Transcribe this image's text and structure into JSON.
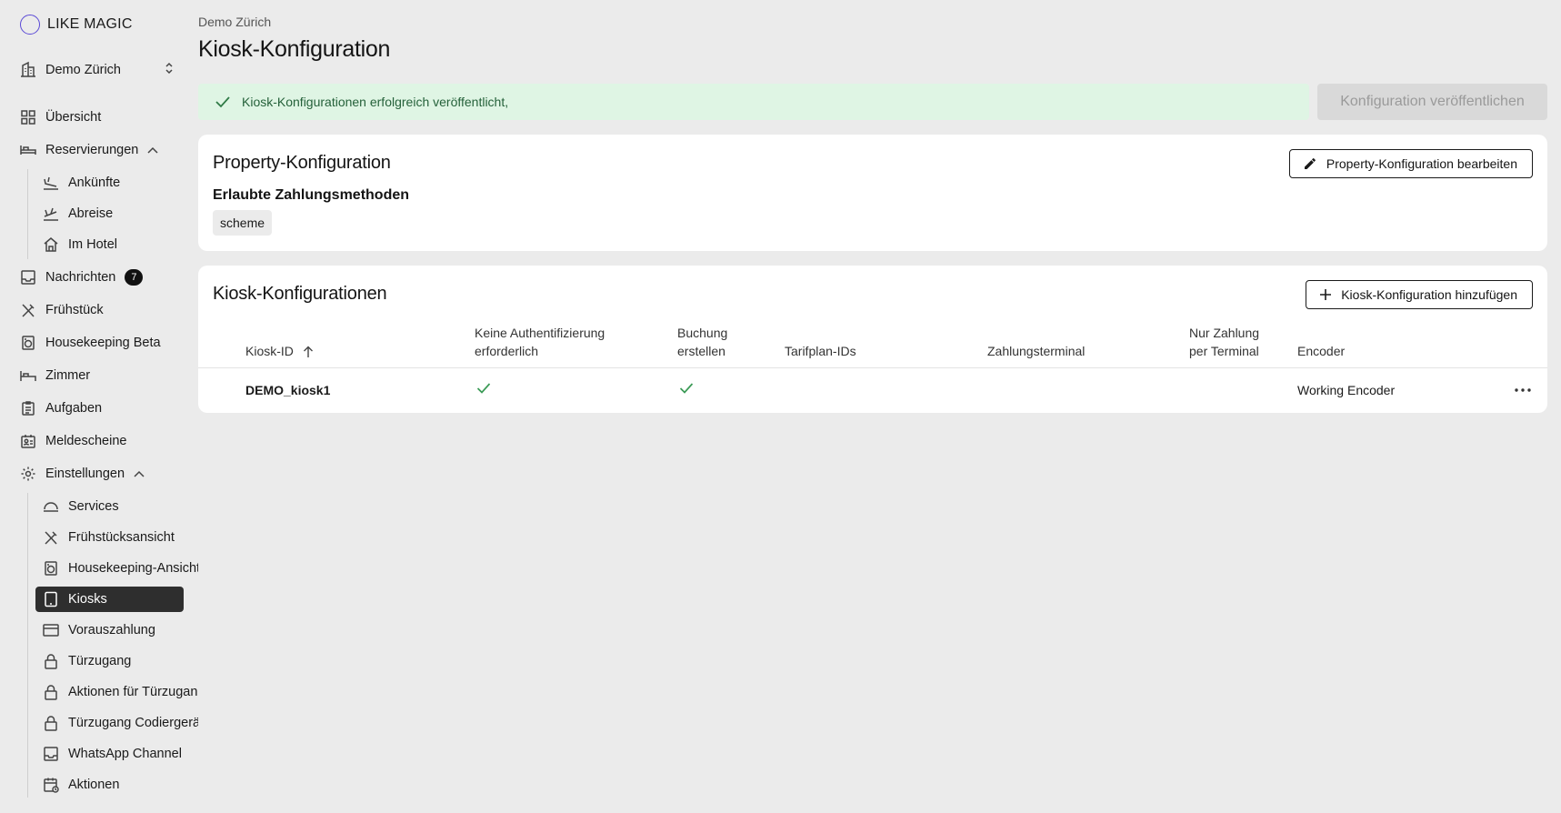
{
  "app": {
    "brand": "LIKE MAGIC"
  },
  "property_switcher": {
    "label": "Demo Zürich"
  },
  "sidebar": {
    "overview": "Übersicht",
    "reservations": "Reservierungen",
    "arrivals": "Ankünfte",
    "departures": "Abreise",
    "in_house": "Im Hotel",
    "messages": "Nachrichten",
    "messages_badge": "7",
    "breakfast": "Frühstück",
    "housekeeping": "Housekeeping Beta",
    "rooms": "Zimmer",
    "tasks": "Aufgaben",
    "registration_forms": "Meldescheine",
    "settings": "Einstellungen",
    "services": "Services",
    "breakfast_view": "Frühstücksansicht",
    "housekeeping_view": "Housekeeping-Ansicht",
    "kiosks": "Kiosks",
    "prepayment": "Vorauszahlung",
    "door_access": "Türzugang",
    "door_access_actions": "Aktionen für Türzugang",
    "door_access_encoder": "Türzugang Codiergerä",
    "whatsapp": "WhatsApp Channel",
    "actions": "Aktionen"
  },
  "header": {
    "breadcrumb": "Demo Zürich",
    "title": "Kiosk-Konfiguration"
  },
  "alert": {
    "message": "Kiosk-Konfigurationen erfolgreich veröffentlicht,"
  },
  "publish_button": "Konfiguration veröffentlichen",
  "property_config": {
    "title": "Property-Konfiguration",
    "edit_button": "Property-Konfiguration bearbeiten",
    "payment_methods_heading": "Erlaubte Zahlungsmethoden",
    "payment_methods": [
      "scheme"
    ]
  },
  "kiosk_configs": {
    "title": "Kiosk-Konfigurationen",
    "add_button": "Kiosk-Konfiguration hinzufügen",
    "columns": {
      "kiosk_id": "Kiosk-ID",
      "no_auth_line1": "Keine Authentifizierung",
      "no_auth_line2": "erforderlich",
      "create_booking_line1": "Buchung",
      "create_booking_line2": "erstellen",
      "rate_plan_ids": "Tarifplan-IDs",
      "payment_terminal": "Zahlungsterminal",
      "terminal_only_line1": "Nur Zahlung",
      "terminal_only_line2": "per Terminal",
      "encoder": "Encoder"
    },
    "rows": [
      {
        "kiosk_id": "DEMO_kiosk1",
        "no_auth_required": true,
        "create_booking": true,
        "rate_plan_ids": "",
        "payment_terminal": "",
        "terminal_only": "",
        "encoder": "Working Encoder"
      }
    ]
  },
  "colors": {
    "background": "#ebebeb",
    "success_bg": "#dff5e4",
    "success_text": "#25613a",
    "check_green": "#3a9a55",
    "active_nav": "#2e2e2e",
    "brand_circle": "#5b4ad6"
  }
}
